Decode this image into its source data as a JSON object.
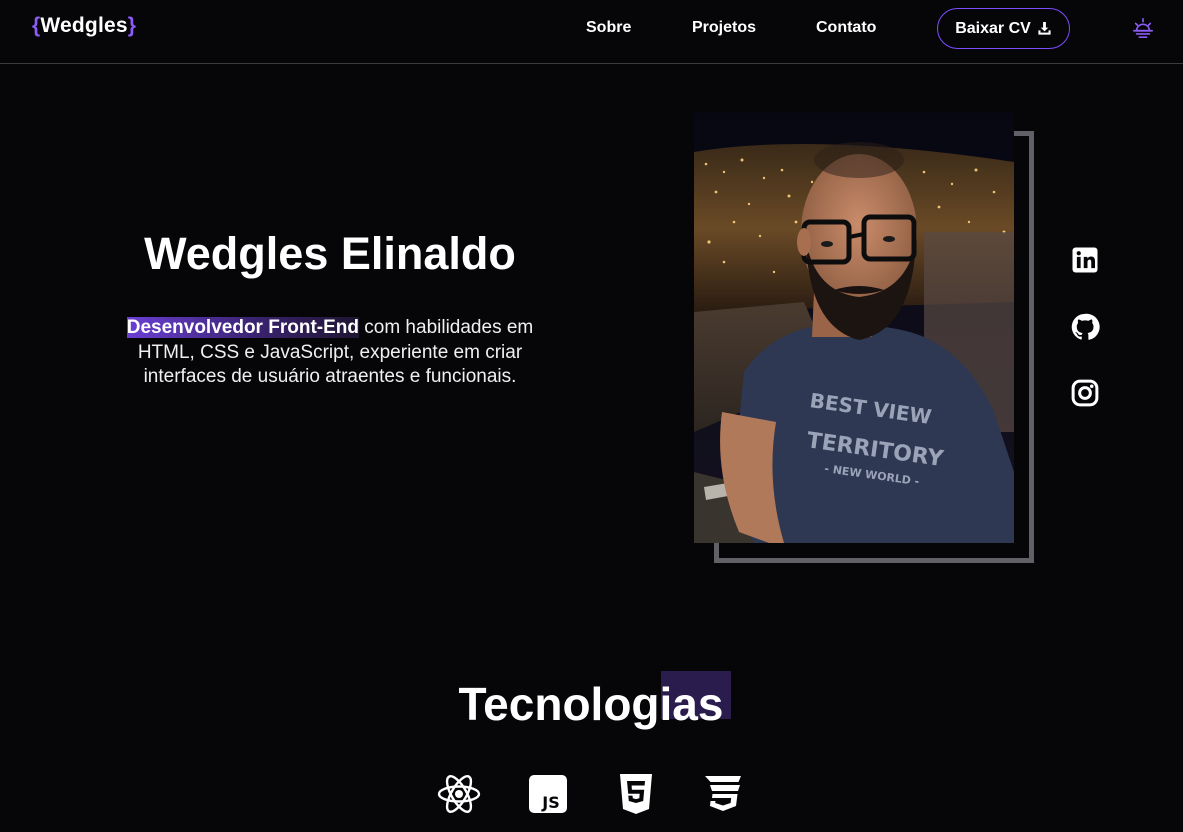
{
  "header": {
    "logo": {
      "open_brace": "{",
      "name": "Wedgles",
      "close_brace": "}"
    },
    "nav": [
      {
        "label": "Sobre"
      },
      {
        "label": "Projetos"
      },
      {
        "label": "Contato"
      }
    ],
    "cv_button_label": "Baixar CV",
    "theme_icon": "sun-icon"
  },
  "hero": {
    "name": "Wedgles Elinaldo",
    "role_highlight": "Desenvolvedor Front-End",
    "description": " com habilidades em HTML, CSS e JavaScript, experiente em criar interfaces de usuário atraentes e funcionais.",
    "photo_icon": "profile-photo"
  },
  "social": [
    {
      "icon": "linkedin-icon"
    },
    {
      "icon": "github-icon"
    },
    {
      "icon": "instagram-icon"
    }
  ],
  "tecnologias": {
    "title": "Tecnologias",
    "icons": [
      "react-icon",
      "javascript-icon",
      "html5-icon",
      "css3-icon"
    ]
  },
  "colors": {
    "background": "#060508",
    "accent": "#8b5cf6",
    "button_border": "#7c4dff",
    "frame": "#606066"
  }
}
